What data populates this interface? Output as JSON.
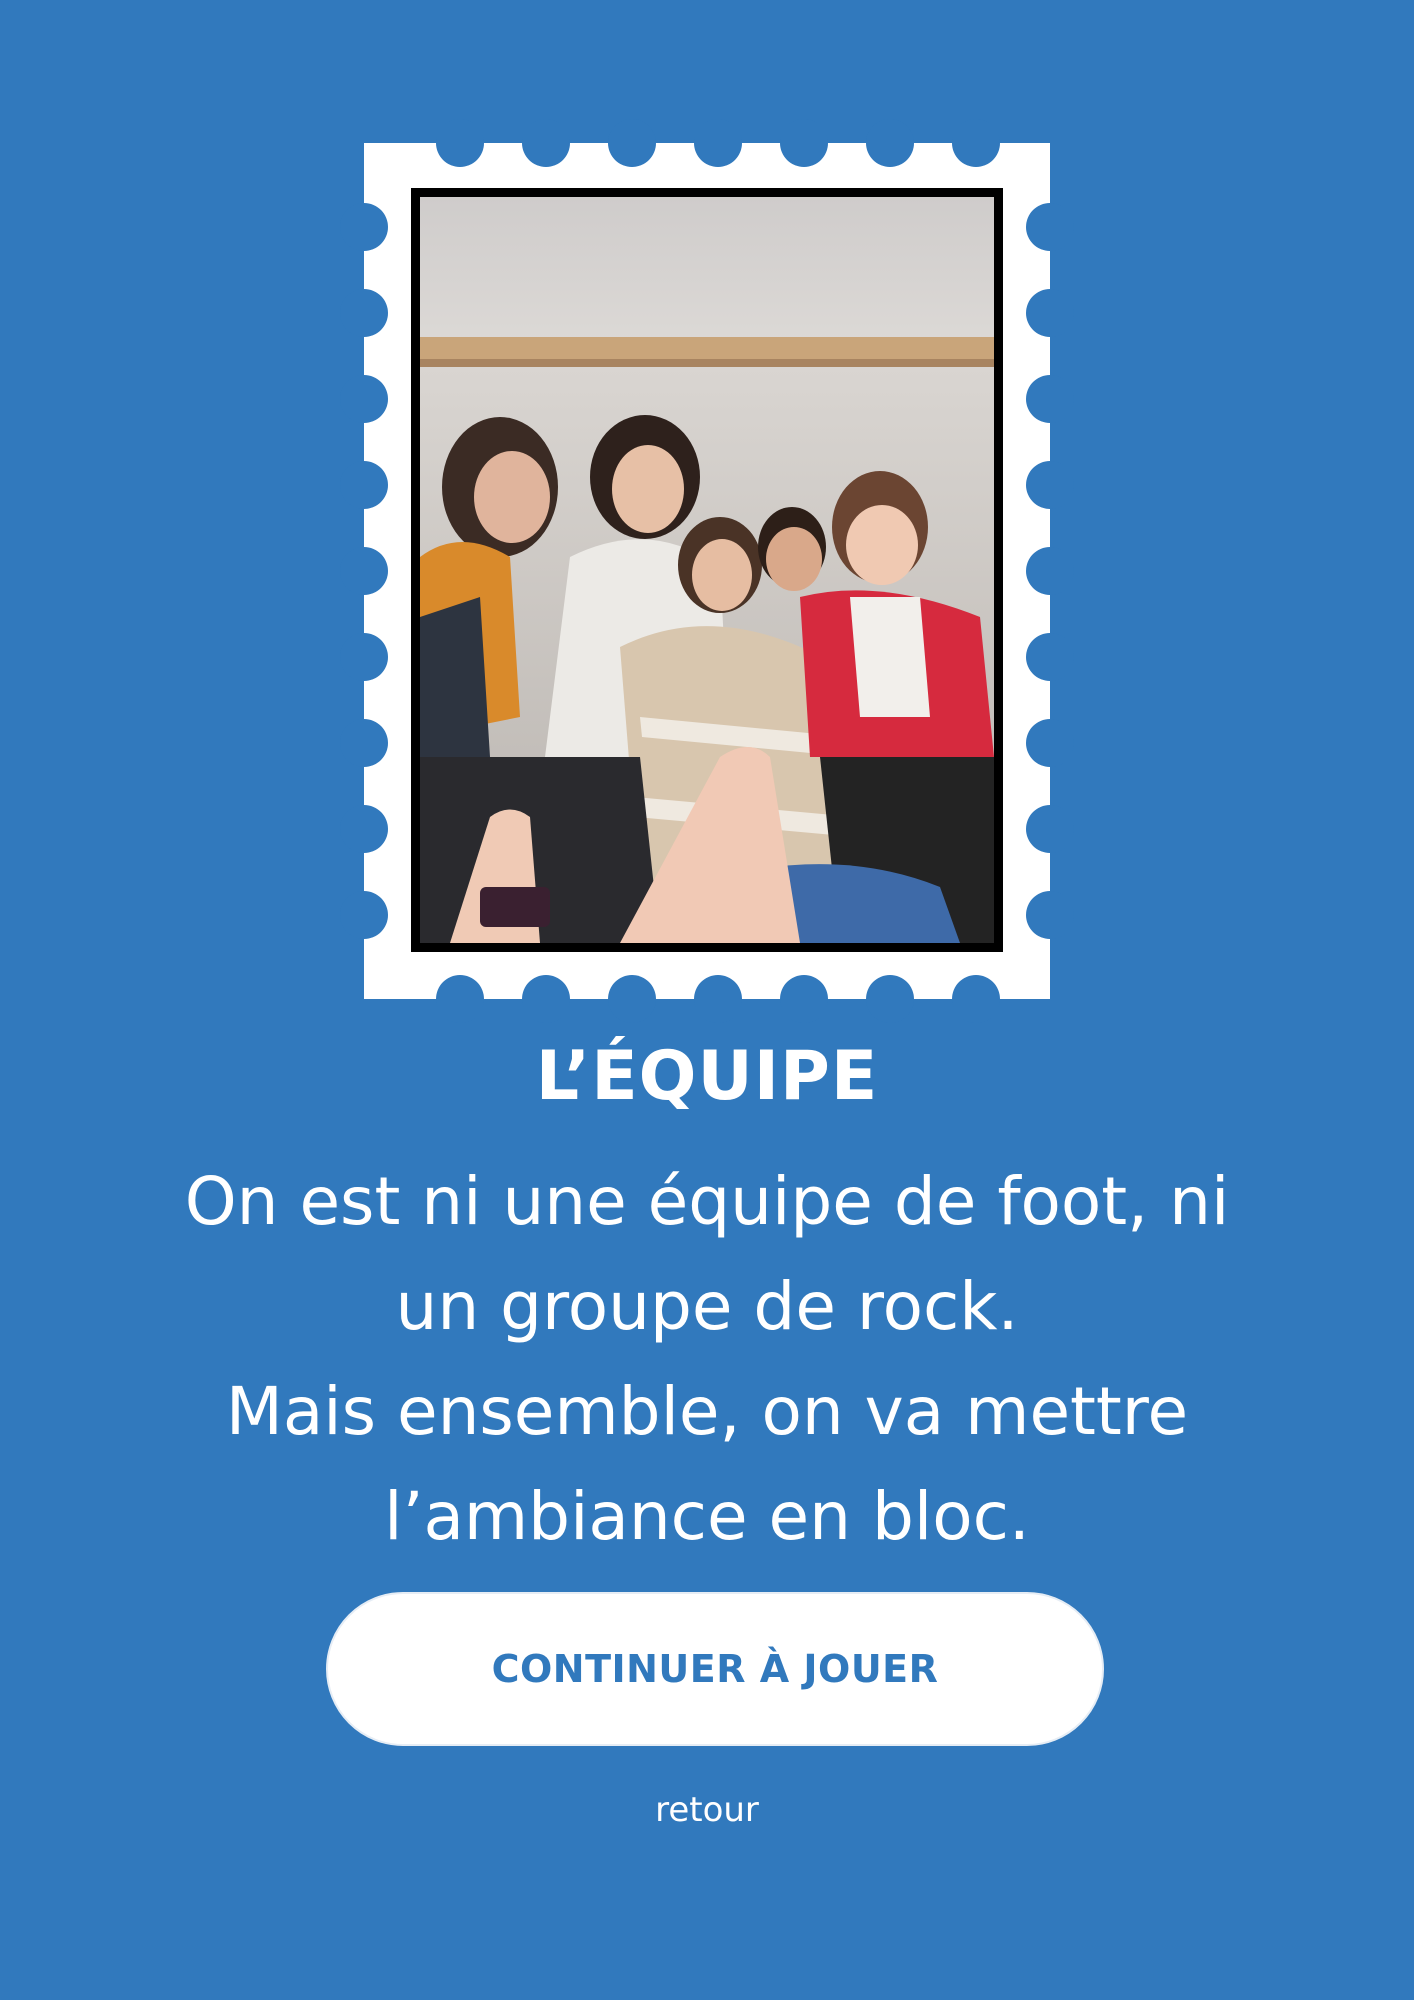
{
  "page": {
    "background_color": "#3179bd",
    "accent_color": "#3179bd"
  },
  "stamp": {
    "photo_description_icon": "group-selfie-photo"
  },
  "content": {
    "title": "L’ÉQUIPE",
    "body_lines": [
      "On est ni une équipe de foot, ni",
      "un groupe de rock.",
      "Mais ensemble, on va mettre",
      "l’ambiance en bloc."
    ]
  },
  "actions": {
    "continue_label": "CONTINUER À JOUER",
    "back_label": "retour"
  }
}
